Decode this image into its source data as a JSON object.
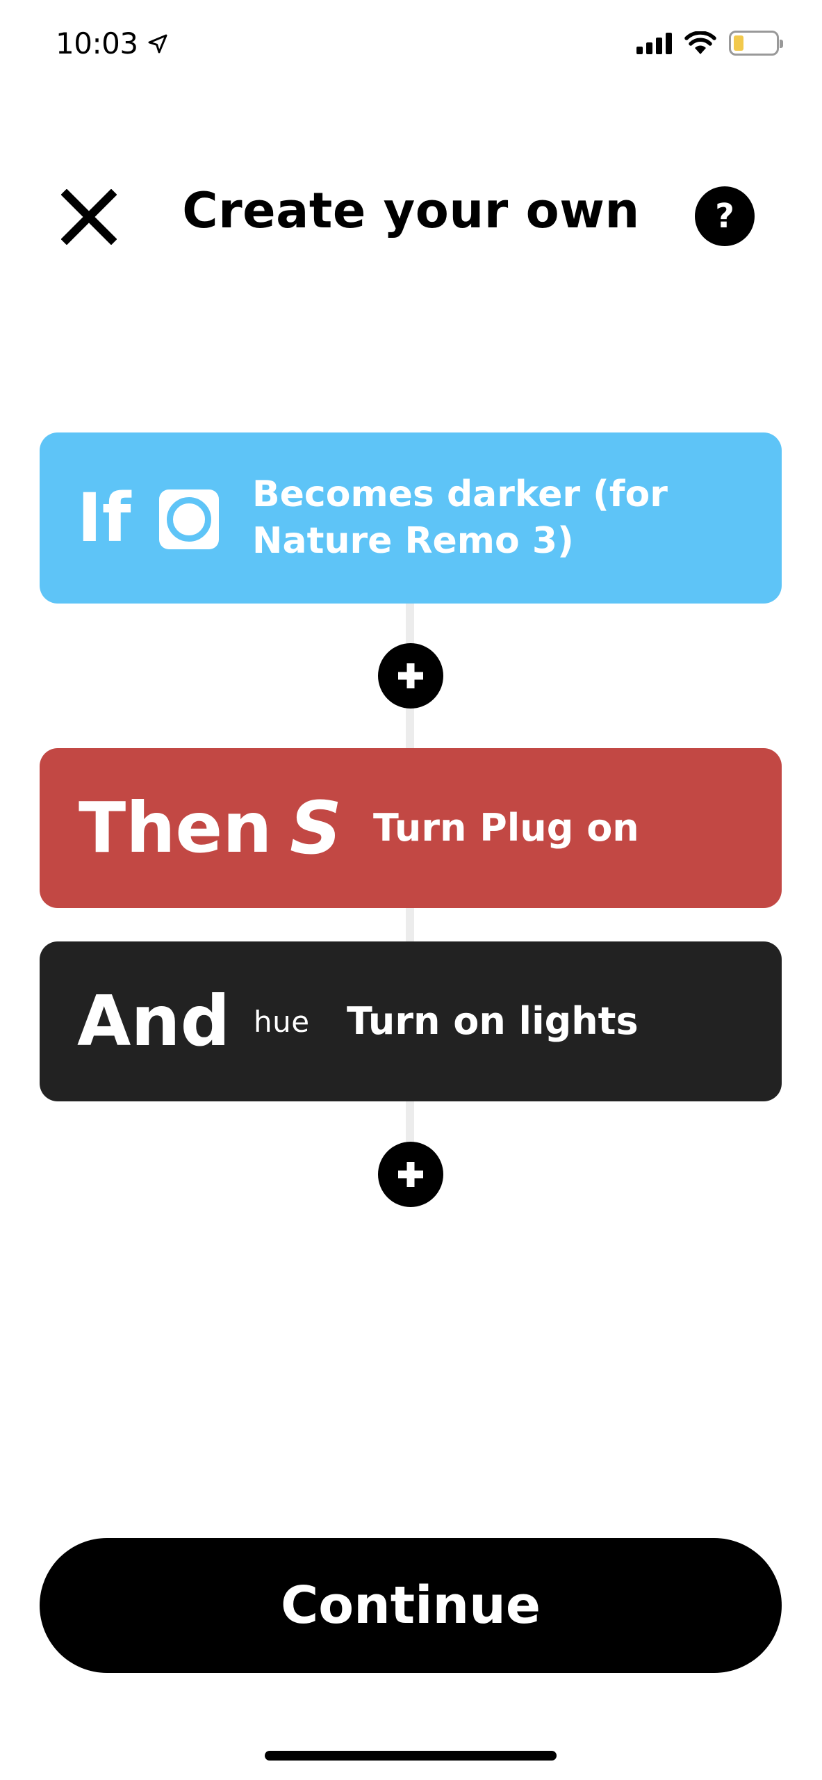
{
  "status_bar": {
    "time": "10:03"
  },
  "header": {
    "title": "Create your own",
    "help_label": "?"
  },
  "trigger": {
    "keyword": "If",
    "service_icon": "nature-remo-icon",
    "text": "Becomes darker (for Nature Remo 3)",
    "color": "#5ec4f7"
  },
  "actions": [
    {
      "keyword": "Then",
      "service_logo_text": "S",
      "text": "Turn Plug on",
      "color": "#c24844"
    },
    {
      "keyword": "And",
      "service_logo_text": "hue",
      "text": "Turn on lights",
      "color": "#222222"
    }
  ],
  "continue_label": "Continue"
}
